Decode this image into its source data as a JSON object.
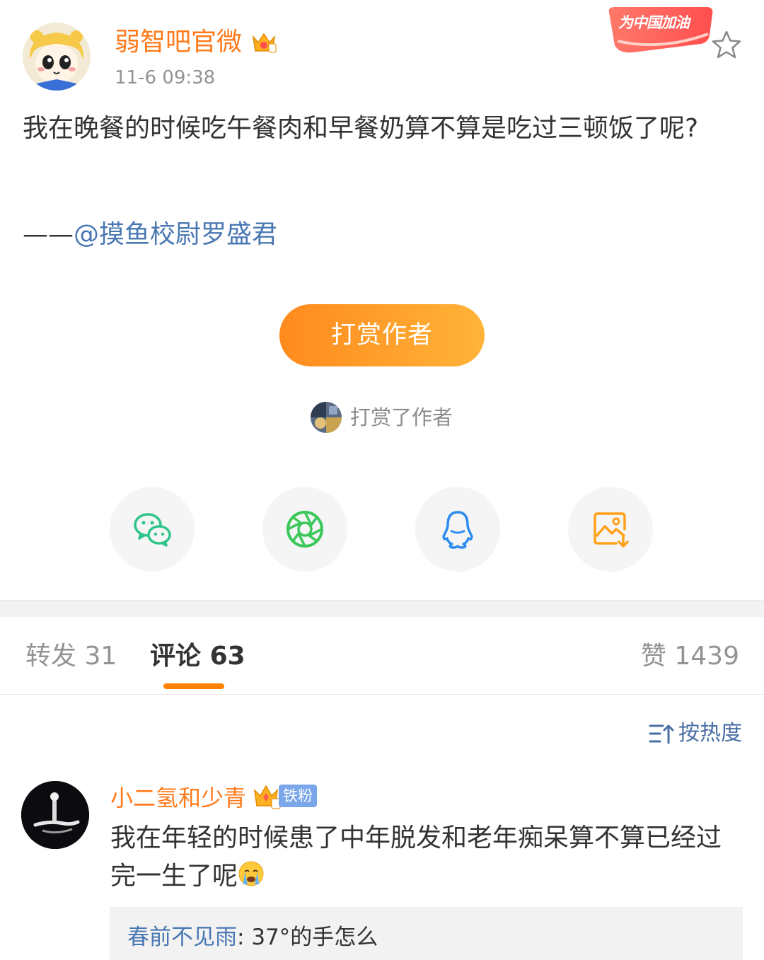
{
  "post": {
    "author_name": "弱智吧官微",
    "time": "11-6 09:38",
    "event_badge_text": "为中国加油",
    "body_text": "我在晚餐的时候吃午餐肉和早餐奶算不算是吃过三顿饭了呢?",
    "signature_prefix": "——",
    "signature_mention": "@摸鱼校尉罗盛君"
  },
  "reward": {
    "button_label": "打赏作者",
    "rewarded_note": "打赏了作者"
  },
  "share": {
    "items": [
      {
        "icon": "wechat-icon",
        "color": "#2fc58a"
      },
      {
        "icon": "moments-icon",
        "color": "#3cc75a"
      },
      {
        "icon": "qq-icon",
        "color": "#2d8cf0"
      },
      {
        "icon": "save-image-icon",
        "color": "#ffa11a"
      }
    ]
  },
  "tabs": {
    "repost_label": "转发",
    "repost_count": "31",
    "comment_label": "评论",
    "comment_count": "63",
    "like_label": "赞",
    "like_count": "1439",
    "active": "comment"
  },
  "sort": {
    "label": "按热度"
  },
  "comments": [
    {
      "user": "小二氢和少青",
      "fan_badge": "铁粉",
      "text": "我在年轻的时候患了中年脱发和老年痴呆算不算已经过完一生了呢",
      "emoji": "crying-face",
      "reply": {
        "user": "春前不见雨",
        "separator": ": ",
        "text": "37°的手怎么"
      }
    }
  ],
  "colors": {
    "brand_orange": "#ff8200",
    "username_orange": "#ff7a1a",
    "link_blue": "#4a78b3",
    "muted_gray": "#939393"
  }
}
